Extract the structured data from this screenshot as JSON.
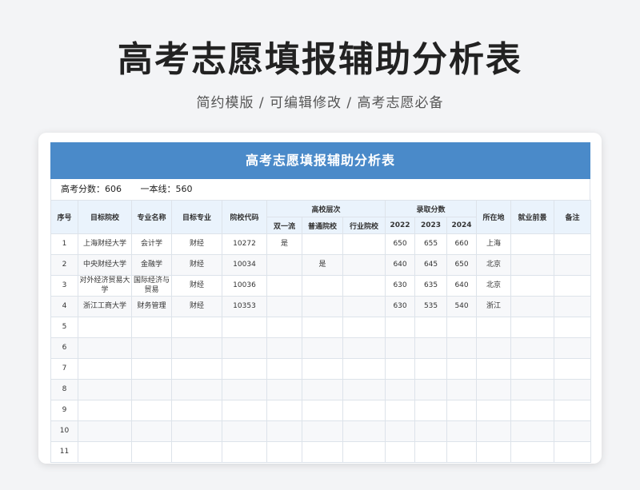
{
  "header": {
    "title": "高考志愿填报辅助分析表",
    "subtitle": "简约模版 /  可编辑修改  / 高考志愿必备"
  },
  "sheet": {
    "title": "高考志愿填报辅助分析表",
    "score_label": "高考分数：606",
    "line_label": "一本线：560"
  },
  "table": {
    "headers": {
      "index": "序号",
      "target_school": "目标院校",
      "major_name": "专业名称",
      "target_major": "目标专业",
      "school_code": "院校代码",
      "school_level": "高校层次",
      "level_double": "双一流",
      "level_regular": "普通院校",
      "level_industry": "行业院校",
      "admission_score": "录取分数",
      "year1": "2022",
      "year2": "2023",
      "year3": "2024",
      "location": "所在地",
      "employment": "就业前景",
      "note": "备注"
    },
    "rows": [
      {
        "index": "1",
        "school": "上海财经大学",
        "major": "会计学",
        "target": "财经",
        "code": "10272",
        "double": "是",
        "regular": "",
        "industry": "",
        "y1": "650",
        "y2": "655",
        "y3": "660",
        "location": "上海",
        "employment": "",
        "note": ""
      },
      {
        "index": "2",
        "school": "中央财经大学",
        "major": "金融学",
        "target": "财经",
        "code": "10034",
        "double": "",
        "regular": "是",
        "industry": "",
        "y1": "640",
        "y2": "645",
        "y3": "650",
        "location": "北京",
        "employment": "",
        "note": ""
      },
      {
        "index": "3",
        "school": "对外经济贸易大学",
        "major": "国际经济与贸易",
        "target": "财经",
        "code": "10036",
        "double": "",
        "regular": "",
        "industry": "",
        "y1": "630",
        "y2": "635",
        "y3": "640",
        "location": "北京",
        "employment": "",
        "note": ""
      },
      {
        "index": "4",
        "school": "浙江工商大学",
        "major": "财务管理",
        "target": "财经",
        "code": "10353",
        "double": "",
        "regular": "",
        "industry": "",
        "y1": "630",
        "y2": "535",
        "y3": "540",
        "location": "浙江",
        "employment": "",
        "note": ""
      },
      {
        "index": "5",
        "school": "",
        "major": "",
        "target": "",
        "code": "",
        "double": "",
        "regular": "",
        "industry": "",
        "y1": "",
        "y2": "",
        "y3": "",
        "location": "",
        "employment": "",
        "note": ""
      },
      {
        "index": "6",
        "school": "",
        "major": "",
        "target": "",
        "code": "",
        "double": "",
        "regular": "",
        "industry": "",
        "y1": "",
        "y2": "",
        "y3": "",
        "location": "",
        "employment": "",
        "note": ""
      },
      {
        "index": "7",
        "school": "",
        "major": "",
        "target": "",
        "code": "",
        "double": "",
        "regular": "",
        "industry": "",
        "y1": "",
        "y2": "",
        "y3": "",
        "location": "",
        "employment": "",
        "note": ""
      },
      {
        "index": "8",
        "school": "",
        "major": "",
        "target": "",
        "code": "",
        "double": "",
        "regular": "",
        "industry": "",
        "y1": "",
        "y2": "",
        "y3": "",
        "location": "",
        "employment": "",
        "note": ""
      },
      {
        "index": "9",
        "school": "",
        "major": "",
        "target": "",
        "code": "",
        "double": "",
        "regular": "",
        "industry": "",
        "y1": "",
        "y2": "",
        "y3": "",
        "location": "",
        "employment": "",
        "note": ""
      },
      {
        "index": "10",
        "school": "",
        "major": "",
        "target": "",
        "code": "",
        "double": "",
        "regular": "",
        "industry": "",
        "y1": "",
        "y2": "",
        "y3": "",
        "location": "",
        "employment": "",
        "note": ""
      },
      {
        "index": "11",
        "school": "",
        "major": "",
        "target": "",
        "code": "",
        "double": "",
        "regular": "",
        "industry": "",
        "y1": "",
        "y2": "",
        "y3": "",
        "location": "",
        "employment": "",
        "note": ""
      }
    ]
  }
}
